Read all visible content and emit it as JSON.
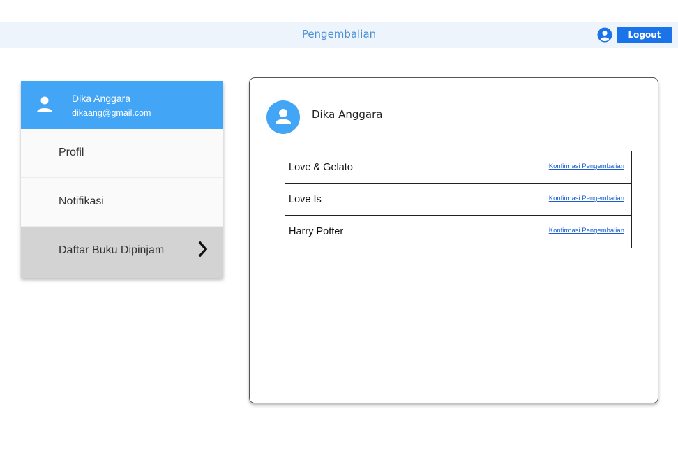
{
  "header": {
    "title": "Pengembalian",
    "user_icon": "user-circle-icon",
    "logout_label": "Logout",
    "accent_color": "#1a73e8"
  },
  "sidebar": {
    "user": {
      "name": "Dika Anggara",
      "email": "dikaang@gmail.com",
      "icon": "person-icon"
    },
    "header_color": "#42a5f5",
    "items": [
      {
        "label": "Profil"
      },
      {
        "label": "Notifikasi"
      },
      {
        "label": "Daftar Buku Dipinjam",
        "active": true,
        "icon": "chevron-right-icon"
      }
    ]
  },
  "main": {
    "user_name": "Dika Anggara",
    "avatar_icon": "person-icon",
    "books": [
      {
        "title": "Love & Gelato",
        "action": "Konfirmasi Pengembalian"
      },
      {
        "title": "Love Is",
        "action": "Konfirmasi Pengembalian"
      },
      {
        "title": "Harry Potter",
        "action": "Konfirmasi Pengembalian"
      }
    ]
  }
}
